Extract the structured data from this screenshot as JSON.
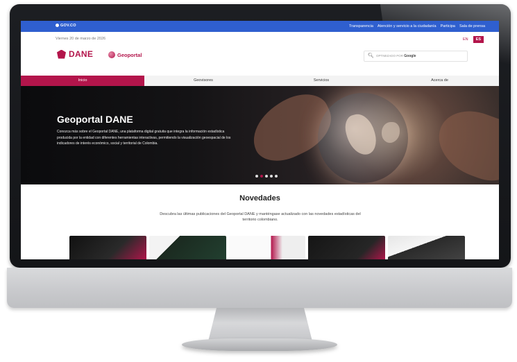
{
  "topbar": {
    "gov_logo": "GOV.CO",
    "links": [
      "Transparencia",
      "Atención y servicio a la ciudadanía",
      "Participa",
      "Sala de prensa"
    ],
    "color": "#2f5fcf"
  },
  "header": {
    "date": "Viernes 20 de marzo de 2026",
    "logo_text": "DANE",
    "geoportal_text": "Geoportal",
    "lang_en": "EN",
    "lang_es": "ES",
    "search_placeholder": "OPTIMIZADO POR",
    "search_brand": "Google",
    "accent": "#b3154b"
  },
  "nav": {
    "items": [
      "Inicio",
      "Geovisores",
      "Servicios",
      "Acerca de"
    ],
    "active": "Inicio"
  },
  "hero": {
    "title": "Geoportal DANE",
    "description": "Conozca más sobre el Geoportal DANE, una plataforma digital gratuita que integra la información estadística producida por la entidad con diferentes herramientas interactivas, permitiendo la visualización geoespacial de los indicadores de interés económico, social y territorial de Colombia.",
    "slides": 5,
    "active_slide": 2
  },
  "news": {
    "title": "Novedades",
    "description": "Descubra las últimas publicaciones del Geoportal DANE y manténgase actualizado con las novedades estadísticas del territorio colombiano.",
    "cards": 5
  }
}
